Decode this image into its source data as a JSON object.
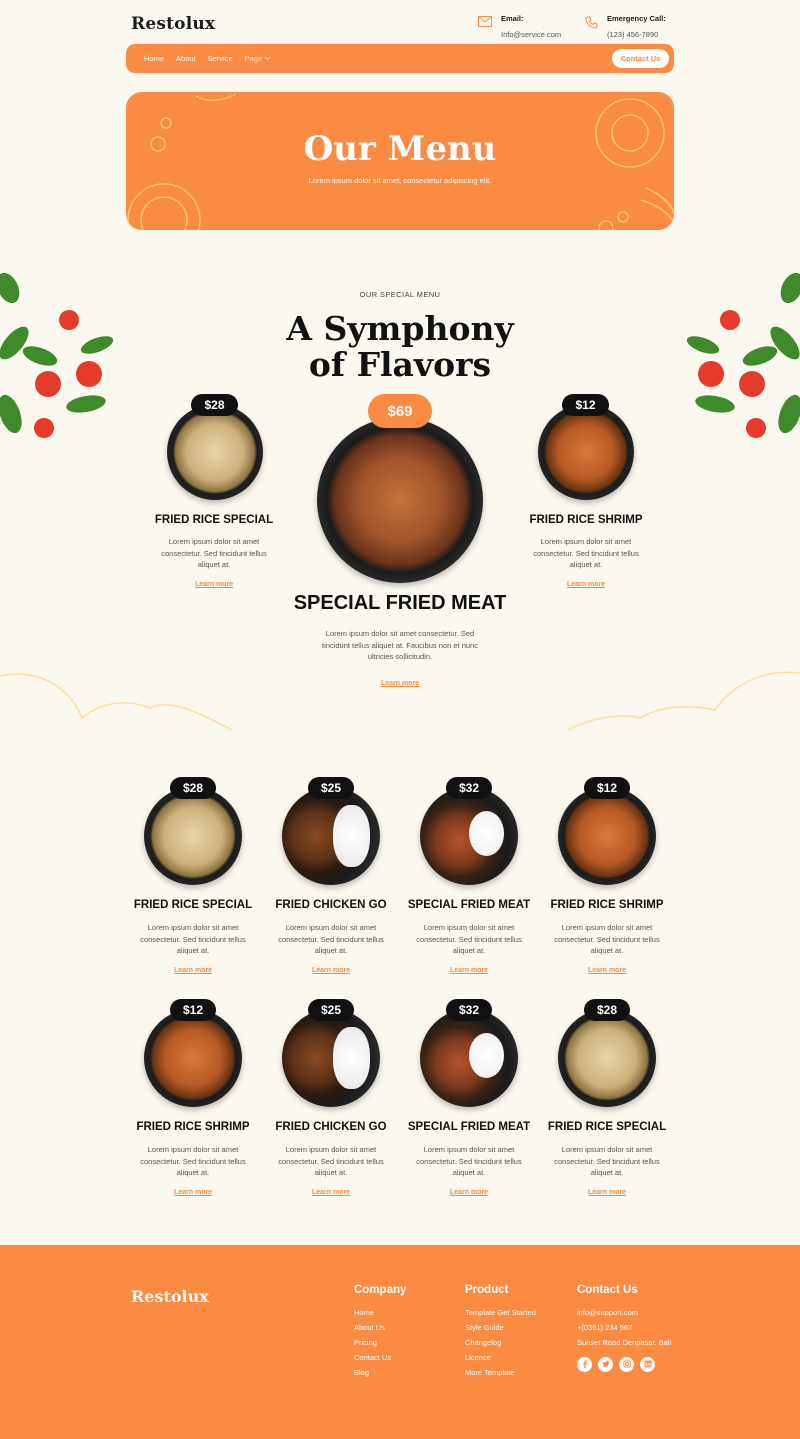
{
  "header": {
    "logo": "Restolux",
    "email_label": "Email:",
    "email_value": "Info@service.com",
    "phone_label": "Emergency Call:",
    "phone_value": "(123) 456-7890",
    "nav": [
      "Home",
      "About",
      "Service",
      "Page"
    ],
    "contact_button": "Contact Us"
  },
  "hero": {
    "title": "Our Menu",
    "subtitle": "Lorem ipsum dolor sit amet, consectetur adipiscing elit."
  },
  "special": {
    "eyebrow": "OUR SPECIAL MENU",
    "title_line1": "A Symphony",
    "title_line2": "of Flavors",
    "left": {
      "price": "$28",
      "title": "FRIED RICE SPECIAL",
      "desc": "Lorem ipsum dolor sit amet consectetur. Sed tincidunt tellus aliquet at.",
      "link": "Learn more"
    },
    "center": {
      "price": "$69",
      "title": "SPECIAL FRIED MEAT",
      "desc": "Lorem ipsum dolor sit amet consectetur. Sed tincidunt tellus aliquet at. Faucibus non et nunc ultricies sollicitudin.",
      "link": "Learn more"
    },
    "right": {
      "price": "$12",
      "title": "FRIED RICE SHRIMP",
      "desc": "Lorem ipsum dolor sit amet consectetur. Sed tincidunt tellus aliquet at.",
      "link": "Learn more"
    }
  },
  "menu": {
    "items": [
      {
        "price": "$28",
        "title": "FRIED RICE SPECIAL",
        "desc": "Lorem ipsum dolor sit amet consectetur. Sed tincidunt tellus aliquet at.",
        "link": "Learn more",
        "dish": "rice"
      },
      {
        "price": "$25",
        "title": "FRIED CHICKEN GO",
        "desc": "Lorem ipsum dolor sit amet consectetur. Sed tincidunt tellus aliquet at.",
        "link": "Learn more",
        "dish": "chicken"
      },
      {
        "price": "$32",
        "title": "SPECIAL FRIED MEAT",
        "desc": "Lorem ipsum dolor sit amet consectetur. Sed tincidunt tellus aliquet at.",
        "link": "Learn more",
        "dish": "meat"
      },
      {
        "price": "$12",
        "title": "FRIED RICE SHRIMP",
        "desc": "Lorem ipsum dolor sit amet consectetur. Sed tincidunt tellus aliquet at.",
        "link": "Learn more",
        "dish": "shrimp"
      },
      {
        "price": "$12",
        "title": "FRIED RICE SHRIMP",
        "desc": "Lorem ipsum dolor sit amet consectetur. Sed tincidunt tellus aliquet at.",
        "link": "Learn more",
        "dish": "shrimp"
      },
      {
        "price": "$25",
        "title": "FRIED CHICKEN GO",
        "desc": "Lorem ipsum dolor sit amet consectetur. Sed tincidunt tellus aliquet at.",
        "link": "Learn more",
        "dish": "chicken"
      },
      {
        "price": "$32",
        "title": "SPECIAL FRIED MEAT",
        "desc": "Lorem ipsum dolor sit amet consectetur. Sed tincidunt tellus aliquet at.",
        "link": "Learn more",
        "dish": "meat"
      },
      {
        "price": "$28",
        "title": "FRIED RICE SPECIAL",
        "desc": "Lorem ipsum dolor sit amet consectetur. Sed tincidunt tellus aliquet at.",
        "link": "Learn more",
        "dish": "rice"
      }
    ]
  },
  "footer": {
    "logo": "Restolux",
    "company_title": "Company",
    "company_links": [
      "Home",
      "About Us",
      "Pricing",
      "Contact Us",
      "Blog"
    ],
    "product_title": "Product",
    "product_links": [
      "Template Get Started",
      "Style Guide",
      "Changelog",
      "Licence",
      "More Template"
    ],
    "contact_title": "Contact Us",
    "contact_email": "info@support.com",
    "contact_phone": "+(0361) 234 567",
    "contact_address": "Sunset Road Denpasar, Bali",
    "socials": [
      "facebook-icon",
      "twitter-icon",
      "instagram-icon",
      "linkedin-icon"
    ]
  },
  "colors": {
    "accent": "#FB8A43",
    "background": "#FAF8EF",
    "dark": "#111111"
  }
}
